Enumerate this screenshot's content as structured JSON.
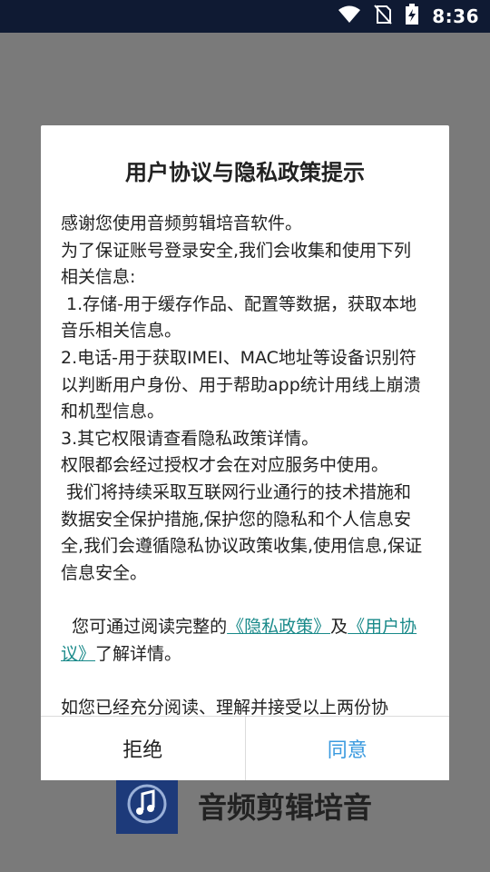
{
  "status_bar": {
    "time": "8:36",
    "icons": [
      "wifi-icon",
      "no-sim-icon",
      "battery-charging-icon"
    ]
  },
  "app": {
    "title": "音频剪辑培音",
    "logo_icon": "music-note-icon"
  },
  "dialog": {
    "title": "用户协议与隐私政策提示",
    "body": {
      "line1": "感谢您使用音频剪辑培音软件。",
      "line2": "为了保证账号登录安全,我们会收集和使用下列相关信息:",
      "item1": " 1.存储-用于缓存作品、配置等数据，获取本地音乐相关信息。",
      "item2": "2.电话-用于获取IMEI、MAC地址等设备识别符以判断用户身份、用于帮助app统计用线上崩溃和机型信息。",
      "item3": "3.其它权限请查看隐私政策详情。",
      "line3": "权限都会经过授权才会在对应服务中使用。",
      "line4": " 我们将持续采取互联网行业通行的技术措施和数据安全保护措施,保护您的隐私和个人信息安全,我们会遵循隐私协议政策收集,使用信息,保证信息安全。",
      "read_prefix": "  您可通过阅读完整的",
      "privacy_link": "《隐私政策》",
      "and": "及",
      "agreement_link": "《用户协议》",
      "read_suffix": "了解详情。",
      "line5": "如您已经充分阅读、理解并接受以上两份协"
    },
    "buttons": {
      "reject": "拒绝",
      "agree": "同意"
    }
  },
  "colors": {
    "status_bar": "#0f1a33",
    "overlay": "#7a7a7a",
    "link": "#1a8a8a",
    "agree": "#3a9adf"
  }
}
